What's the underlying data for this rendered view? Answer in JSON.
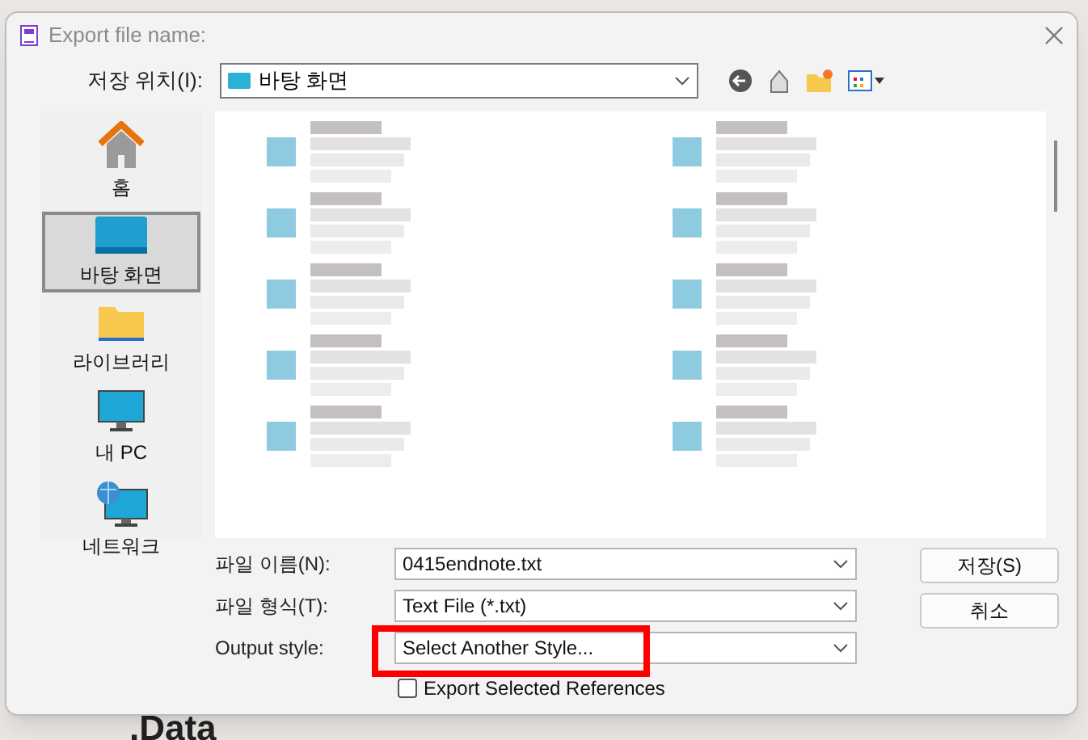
{
  "background": {
    "texts": [
      ".Data"
    ]
  },
  "window": {
    "title": "Export file name:"
  },
  "location": {
    "label": "저장 위치(I):",
    "value": "바탕 화면"
  },
  "sidebar": {
    "items": [
      {
        "label": "홈",
        "selected": false
      },
      {
        "label": "바탕 화면",
        "selected": true
      },
      {
        "label": "라이브러리",
        "selected": false
      },
      {
        "label": "내 PC",
        "selected": false
      },
      {
        "label": "네트워크",
        "selected": false
      }
    ]
  },
  "fields": [
    {
      "label": "파일 이름(N):",
      "value": "0415endnote.txt"
    },
    {
      "label": "파일 형식(T):",
      "value": "Text File (*.txt)"
    },
    {
      "label": "Output style:",
      "value": "Select Another Style..."
    }
  ],
  "checkbox": {
    "label": "Export Selected References",
    "checked": false
  },
  "buttons": [
    "저장(S)",
    "취소"
  ],
  "annotation": {
    "kind": "rectangle",
    "color": "#ff0000"
  }
}
